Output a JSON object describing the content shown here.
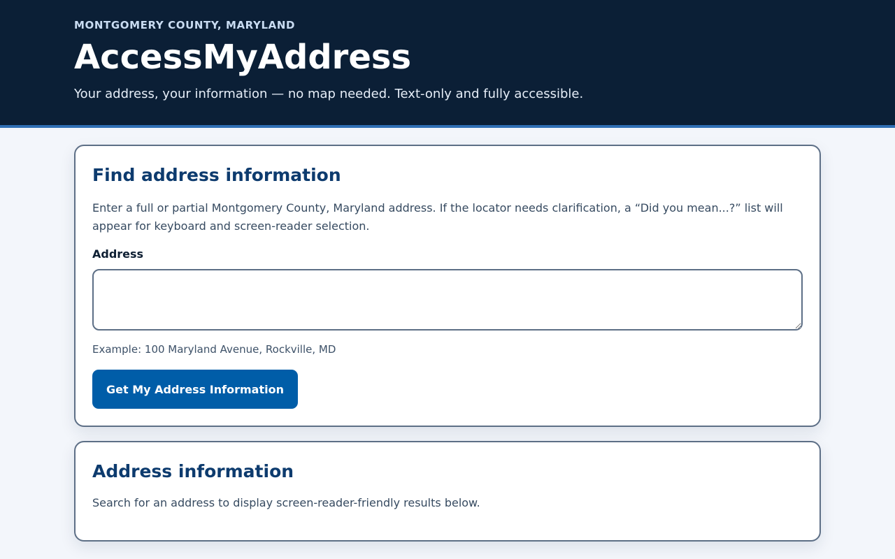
{
  "header": {
    "county": "MONTGOMERY COUNTY, MARYLAND",
    "title": "AccessMyAddress",
    "tagline": "Your address, your information — no map needed. Text-only and fully accessible."
  },
  "search": {
    "heading": "Find address information",
    "intro": "Enter a full or partial Montgomery County, Maryland address. If the locator needs clarification, a “Did you mean...?” list will appear for keyboard and screen-reader selection.",
    "field_label": "Address",
    "input_value": "",
    "example": "Example: 100 Maryland Avenue, Rockville, MD",
    "submit_label": "Get My Address Information"
  },
  "results": {
    "heading": "Address information",
    "text": "Search for an address to display screen-reader-friendly results below."
  },
  "colors": {
    "header_bg": "#0b1f36",
    "accent_border": "#2f6fb5",
    "heading": "#0d3b6e",
    "button": "#005da8"
  }
}
